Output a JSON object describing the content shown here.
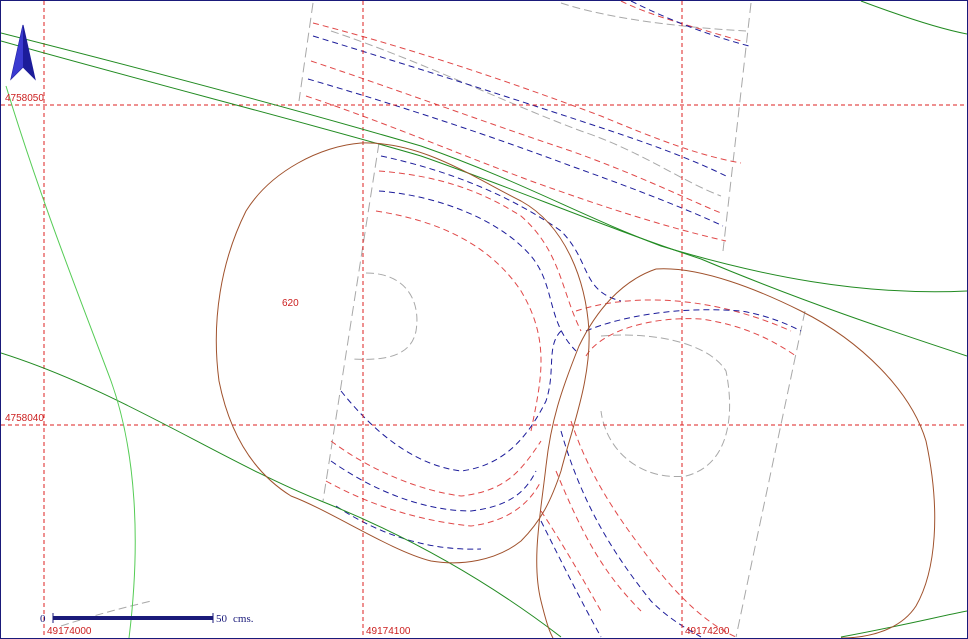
{
  "map": {
    "grid": {
      "x_labels": [
        "49174000",
        "49174100",
        "49174200"
      ],
      "y_labels": [
        "4758050",
        "4758040"
      ]
    },
    "spot_elevations": [
      "620"
    ],
    "scale_bar": {
      "start_label": "0",
      "end_label": "50",
      "unit": "cms."
    },
    "north_arrow_icon": "north-arrow-icon",
    "colors": {
      "grid": "#dd2222",
      "contour_blue": "#1c1c9a",
      "contour_red": "#e04848",
      "contour_grey": "#a8a8a8",
      "road_green": "#228b22",
      "path_lightgreen": "#55cc55",
      "boundary_brown": "#a0522d",
      "frame": "#1a1a7a"
    }
  }
}
